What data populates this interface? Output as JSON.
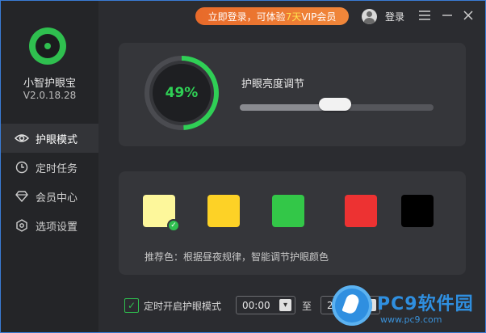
{
  "app": {
    "name": "小智护眼宝",
    "version": "V2.0.18.28"
  },
  "topbar": {
    "promo_prefix": "立即登录，可体验",
    "promo_highlight": "7天",
    "promo_suffix": "VIP会员",
    "login_label": "登录"
  },
  "sidebar": {
    "items": [
      {
        "label": "护眼模式",
        "icon": "eye-icon",
        "active": true
      },
      {
        "label": "定时任务",
        "icon": "clock-icon",
        "active": false
      },
      {
        "label": "会员中心",
        "icon": "diamond-icon",
        "active": false
      },
      {
        "label": "选项设置",
        "icon": "hexagon-settings-icon",
        "active": false
      }
    ]
  },
  "brightness": {
    "percent_text": "49%",
    "percent": 49,
    "title": "护眼亮度调节",
    "slider_value": 0.49
  },
  "colors": {
    "swatches": [
      {
        "name": "light-yellow",
        "hex": "#fdf79b",
        "selected": true
      },
      {
        "name": "yellow",
        "hex": "#fdd226",
        "selected": false
      },
      {
        "name": "green",
        "hex": "#33c748",
        "selected": false
      },
      {
        "name": "red",
        "hex": "#ed3232",
        "selected": false
      },
      {
        "name": "black",
        "hex": "#000000",
        "selected": false
      }
    ],
    "recommend_text": "推荐色：根据昼夜规律，智能调节护眼颜色"
  },
  "timer": {
    "checkbox_label": "定时开启护眼模式",
    "checked": true,
    "start_time": "00:00",
    "to_label": "至",
    "end_time": "2"
  },
  "watermark": {
    "text": "PC9软件园",
    "url": "www.pc9.com"
  },
  "theme": {
    "accent": "#2fbf4f",
    "promo": "#ec7a34"
  }
}
